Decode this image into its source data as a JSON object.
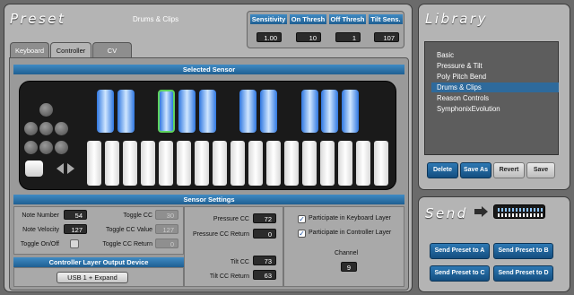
{
  "preset": {
    "title": "Preset",
    "name": "Drums & Clips",
    "params": [
      {
        "label": "Sensitivity",
        "value": "1.00"
      },
      {
        "label": "On Thresh",
        "value": "10"
      },
      {
        "label": "Off Thresh",
        "value": "1"
      },
      {
        "label": "Tilt Sens.",
        "value": "107"
      }
    ],
    "tabs": [
      "Keyboard",
      "Controller",
      "CV"
    ],
    "active_tab": "Controller"
  },
  "selected_sensor": {
    "title": "Selected Sensor"
  },
  "sensor_settings": {
    "title": "Sensor Settings",
    "note_number_label": "Note Number",
    "note_number": "54",
    "note_velocity_label": "Note Velocity",
    "note_velocity": "127",
    "toggle_onoff_label": "Toggle On/Off",
    "toggle_cc_label": "Toggle CC",
    "toggle_cc": "30",
    "toggle_cc_value_label": "Toggle CC Value",
    "toggle_cc_value": "127",
    "toggle_cc_return_label": "Toggle CC Return",
    "toggle_cc_return": "0",
    "pressure_cc_label": "Pressure CC",
    "pressure_cc": "72",
    "pressure_cc_return_label": "Pressure CC Return",
    "pressure_cc_return": "0",
    "tilt_cc_label": "Tilt CC",
    "tilt_cc": "73",
    "tilt_cc_return_label": "Tilt CC Return",
    "tilt_cc_return": "63",
    "participate_keyboard": "Participate in Keyboard Layer",
    "participate_controller": "Participate in Controller Layer",
    "channel_label": "Channel",
    "channel": "9"
  },
  "output_device": {
    "title": "Controller Layer Output Device",
    "value": "USB 1 + Expand"
  },
  "library": {
    "title": "Library",
    "items": [
      "Basic",
      "Pressure & Tilt",
      "Poly Pitch Bend",
      "Drums & Clips",
      "Reason Controls",
      "SymphonixEvolution"
    ],
    "selected": "Drums & Clips",
    "buttons": {
      "delete": "Delete",
      "save_as": "Save As",
      "revert": "Revert",
      "save": "Save"
    }
  },
  "send": {
    "title": "Send",
    "buttons": [
      "Send Preset to A",
      "Send Preset to B",
      "Send Preset to C",
      "Send Preset to D"
    ]
  },
  "colors": {
    "accent_blue": "#1f5f92",
    "selected_key_outline": "#5fd35f",
    "panel_gray": "#b4b4b4"
  }
}
